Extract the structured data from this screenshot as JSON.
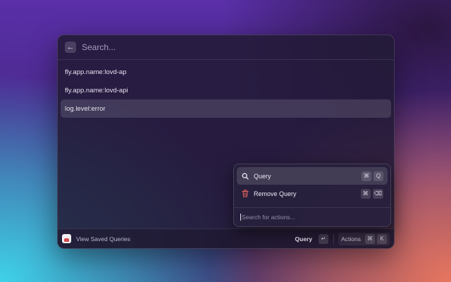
{
  "search": {
    "placeholder": "Search...",
    "back_icon": "arrow-left-icon"
  },
  "list": {
    "items": [
      {
        "label": "fly.app.name:lovd-ap"
      },
      {
        "label": "fly.app.name:lovd-api"
      },
      {
        "label": "log.level:error",
        "selected": true
      }
    ]
  },
  "footer": {
    "app_icon": "app-logo-icon",
    "title": "View Saved Queries",
    "primary_action_label": "Query",
    "primary_action_key": "↵",
    "actions_label": "Actions",
    "actions_keys": [
      "⌘",
      "K"
    ]
  },
  "actions_menu": {
    "items": [
      {
        "label": "Query",
        "icon": "search-icon",
        "keys": [
          "⌘",
          "Q"
        ],
        "selected": true
      },
      {
        "label": "Remove Query",
        "icon": "trash-icon",
        "keys": [
          "⌘",
          "⌫"
        ]
      }
    ],
    "search_placeholder": "Search for actions..."
  },
  "colors": {
    "accent_remove": "#e0605a",
    "panel_bg": "#221a34"
  }
}
